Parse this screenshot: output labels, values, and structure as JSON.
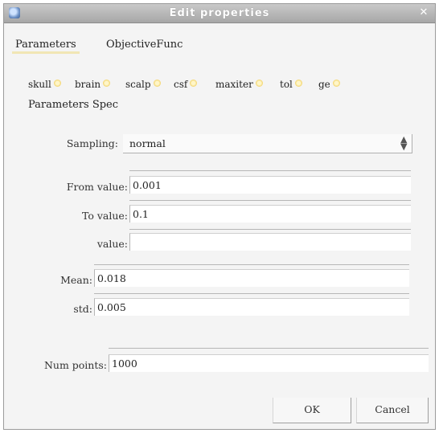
{
  "window": {
    "title": "Edit properties"
  },
  "tabs": [
    {
      "label": "Parameters",
      "active": true
    },
    {
      "label": "ObjectiveFunc",
      "active": false
    }
  ],
  "parameter_tabs": [
    "skull",
    "brain",
    "scalp",
    "csf",
    "maxiter",
    "tol",
    "ge"
  ],
  "section_title": "Parameters Spec",
  "sampling": {
    "label": "Sampling:",
    "value": "normal"
  },
  "fields": {
    "from": {
      "label": "From value:",
      "value": "0.001"
    },
    "to": {
      "label": "To value:",
      "value": "0.1"
    },
    "value": {
      "label": "value:",
      "value": ""
    },
    "mean": {
      "label": "Mean:",
      "value": "0.018"
    },
    "std": {
      "label": "std:",
      "value": "0.005"
    },
    "num_points": {
      "label": "Num points:",
      "value": "1000"
    }
  },
  "buttons": {
    "ok": "OK",
    "cancel": "Cancel"
  },
  "colors": {
    "accent_dot": "#f2d36a",
    "titlebar": "#b3b3b3"
  }
}
